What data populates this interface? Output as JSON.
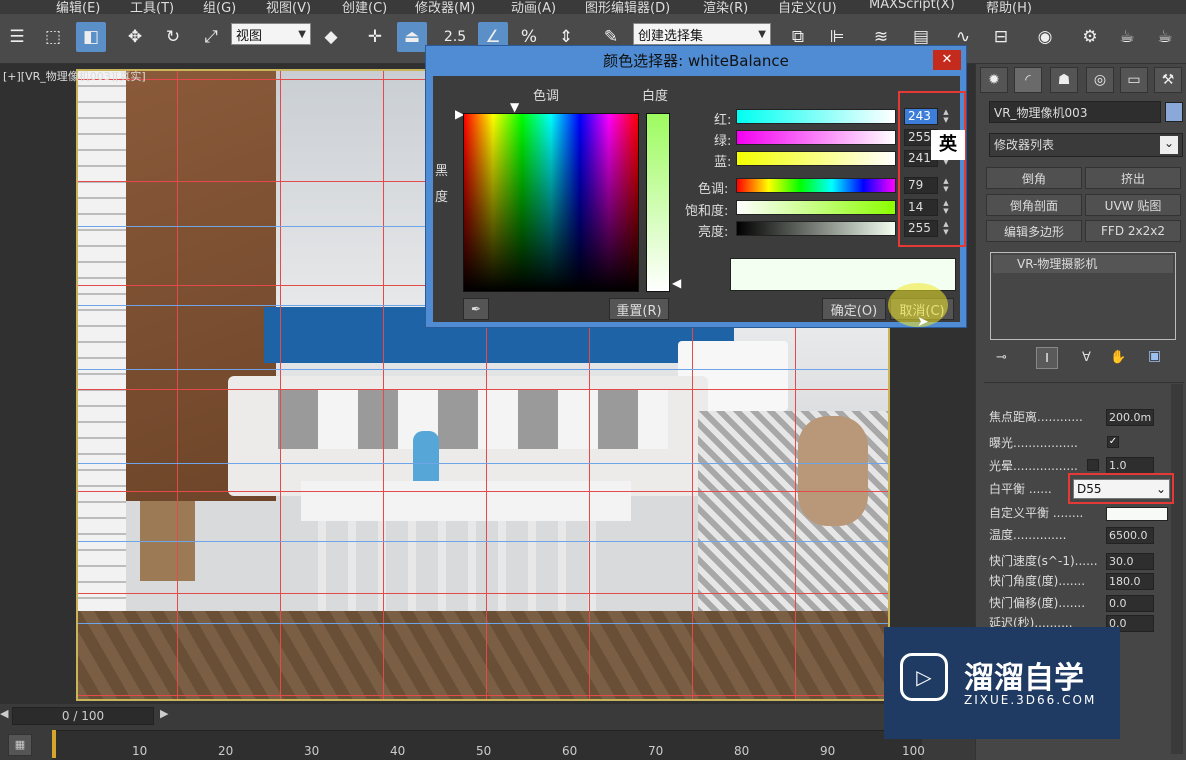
{
  "menu": {
    "items": [
      "编辑(E)",
      "工具(T)",
      "组(G)",
      "视图(V)",
      "创建(C)",
      "修改器(M)",
      "动画(A)",
      "图形编辑器(D)",
      "渲染(R)",
      "自定义(U)",
      "MAXScript(X)",
      "帮助(H)"
    ]
  },
  "toolbar": {
    "view_select": "视图",
    "snap_label": "2.5",
    "selection_set": "创建选择集"
  },
  "viewport": {
    "label": "[+][VR_物理像机003][真实]"
  },
  "timeline": {
    "frame_display": "0 / 100",
    "ticks": [
      "10",
      "20",
      "30",
      "40",
      "50",
      "60",
      "70",
      "80",
      "90",
      "100"
    ]
  },
  "command_panel": {
    "object_name": "VR_物理像机003",
    "modifier_list": "修改器列表",
    "modifier_buttons": [
      "倒角",
      "挤出",
      "倒角剖面",
      "UVW 贴图",
      "编辑多边形",
      "FFD 2x2x2"
    ],
    "stack_item": "VR-物理摄影机",
    "params": {
      "focus_distance_label": "焦点距离............",
      "focus_distance_value": "200.0m",
      "exposure_label": "曝光.................",
      "exposure_check": "✓",
      "vignette_label": "光晕.................",
      "vignette_value": "1.0",
      "white_balance_label": "白平衡 ......",
      "white_balance_value": "D55",
      "custom_balance_label": "自定义平衡 ........",
      "temperature_label": "温度..............",
      "temperature_value": "6500.0",
      "shutter_speed_label": "快门速度(s^-1)......",
      "shutter_speed_value": "30.0",
      "shutter_angle_label": "快门角度(度).......",
      "shutter_angle_value": "180.0",
      "shutter_offset_label": "快门偏移(度).......",
      "shutter_offset_value": "0.0",
      "latency_label": "延迟(秒)..........",
      "latency_value": "0.0"
    }
  },
  "dialog": {
    "title": "颜色选择器: whiteBalance",
    "close_glyph": "✕",
    "hue_label": "色调",
    "whiteness_label": "白度",
    "blackness_label": "黑度",
    "red_label": "红:",
    "green_label": "绿:",
    "blue_label": "蓝:",
    "hue2_label": "色调:",
    "saturation_label": "饱和度:",
    "value_label": "亮度:",
    "red": "243",
    "green": "255",
    "blue": "241",
    "hue": "79",
    "saturation": "14",
    "brightness": "255",
    "ime_indicator": "英",
    "reset_button": "重置(R)",
    "ok_button": "确定(O)",
    "cancel_button": "取消(C)",
    "sample_color": "#f3fff1"
  },
  "watermark": {
    "name": "溜溜自学",
    "url": "ZIXUE.3D66.COM"
  }
}
